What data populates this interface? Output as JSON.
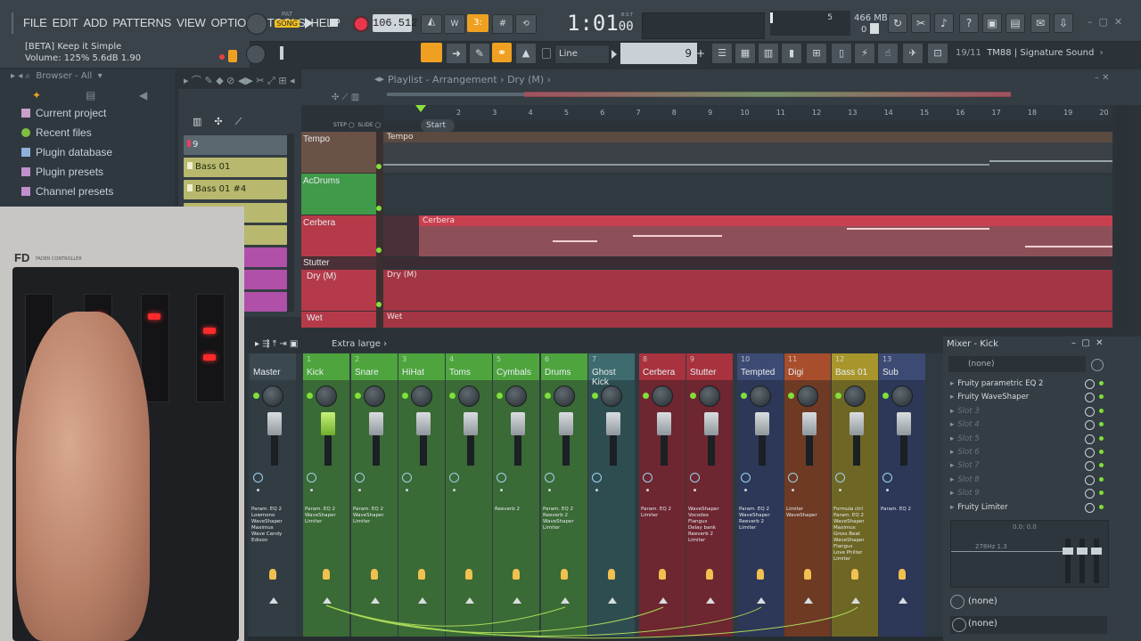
{
  "menus": [
    "FILE",
    "EDIT",
    "ADD",
    "PATTERNS",
    "VIEW",
    "OPTIONS",
    "TOOLS",
    "HELP"
  ],
  "hint_bar": {
    "title": "[BETA] Keep it Simple",
    "volume": "Volume: 125%  5.6dB  1.90"
  },
  "transport": {
    "pat_label": "PAT",
    "song_label": "SONG",
    "tempo": "106.512",
    "time": "1:01",
    "time_sub": "00",
    "time_caption": "B:S:T"
  },
  "cpu": {
    "cpu_value": "5",
    "mem": "466 MB",
    "voices": "0"
  },
  "toolbar2": {
    "snap": "Line",
    "pattern_number": "9",
    "news": "19/11",
    "news_text": "TM88 | Signature Sound"
  },
  "browser": {
    "header": "Browser - All",
    "items": [
      "Current project",
      "Recent files",
      "Plugin database",
      "Plugin presets",
      "Channel presets"
    ]
  },
  "channel_rack": {
    "channels": [
      "9",
      "Bass 01",
      "Bass 01 #4"
    ]
  },
  "playlist": {
    "title": "Playlist - Arrangement",
    "pattern": "Dry (M)",
    "start_marker": "Start",
    "ticks": [
      "2",
      "3",
      "4",
      "5",
      "6",
      "7",
      "8",
      "9",
      "10",
      "11",
      "12",
      "13",
      "14",
      "15",
      "16",
      "17",
      "18",
      "19",
      "20"
    ],
    "tracks": [
      {
        "name": "Tempo",
        "clip": "Tempo"
      },
      {
        "name": "AcDrums",
        "clip": ""
      },
      {
        "name": "Cerbera",
        "clip": "Cerbera"
      },
      {
        "name": "Stutter",
        "clip": ""
      },
      {
        "name": "Dry (M)",
        "clip": "Dry (M)"
      },
      {
        "name": "Wet",
        "clip": "Wet"
      }
    ]
  },
  "controller": {
    "brand": "FD",
    "model": "FADER CONTROLLER"
  },
  "mixer": {
    "size": "Extra large",
    "strips": [
      {
        "num": "",
        "name": "Master",
        "fx": ""
      },
      {
        "num": "1",
        "name": "Kick",
        "fx": "Param. EQ 2\nWaveShaper\nLimiter"
      },
      {
        "num": "2",
        "name": "Snare",
        "fx": "Param. EQ 2\nWaveShaper\nLimiter"
      },
      {
        "num": "3",
        "name": "HiHat",
        "fx": ""
      },
      {
        "num": "4",
        "name": "Toms",
        "fx": ""
      },
      {
        "num": "5",
        "name": "Cymbals",
        "fx": "Reeverb 2"
      },
      {
        "num": "6",
        "name": "Drums",
        "fx": "Param. EQ 2\nReeverb 2\nWaveShaper\nLimiter"
      },
      {
        "num": "7",
        "name": "Ghost Kick",
        "fx": ""
      },
      {
        "num": "8",
        "name": "Cerbera",
        "fx": "Param. EQ 2\nLimiter"
      },
      {
        "num": "9",
        "name": "Stutter",
        "fx": "WaveShaper\nVocodex\nFlangus\nDelay bank\nReeverb 2\nLimiter"
      },
      {
        "num": "10",
        "name": "Tempted",
        "fx": "Param. EQ 2\nWaveShaper\nReeverb 2\nLimiter"
      },
      {
        "num": "11",
        "name": "Digi",
        "fx": "Limiter\nWaveShaper"
      },
      {
        "num": "12",
        "name": "Bass 01",
        "fx": "Formula ctrl\nParam. EQ 2\nWaveShaper\nMaximus\nGross Beat\nWaveShaper\nFlangus\nLove Philter\nLimiter"
      },
      {
        "num": "13",
        "name": "Sub",
        "fx": "Param. EQ 2"
      }
    ],
    "master_fx": "Param. EQ 2\nLowmono\nWaveShaper\nMaximus\nWave Candy\nEdison"
  },
  "mixer_panel": {
    "title": "Mixer - Kick",
    "input": "(none)",
    "slots": [
      "Fruity parametric EQ 2",
      "Fruity WaveShaper",
      "Slot 3",
      "Slot 4",
      "Slot 5",
      "Slot 6",
      "Slot 7",
      "Slot 8",
      "Slot 9",
      "Fruity Limiter"
    ],
    "eq_label1": "0.0: 0.0",
    "eq_label2": "278Hz 1.3",
    "out1": "(none)",
    "out2": "(none)"
  }
}
